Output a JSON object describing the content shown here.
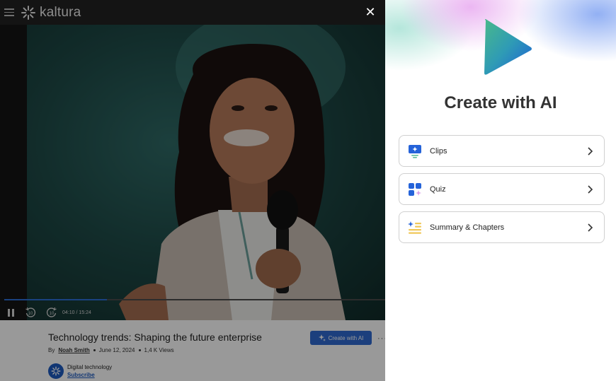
{
  "player": {
    "logo_text": "kaltura",
    "time": "04:10 / 15:24",
    "skip_back_label": "10",
    "skip_forward_label": "10",
    "progress_fraction": 0.27
  },
  "video": {
    "title": "Technology trends: Shaping the future enterprise",
    "by_label": "By",
    "author": "Noah Smith",
    "date": "June 12, 2024",
    "views": "1,4 K Views",
    "create_ai_label": "Create with AI",
    "more_label": "···"
  },
  "channel": {
    "name": "Digital technology",
    "subscribe_label": "Subscribe"
  },
  "panel": {
    "title": "Create with AI",
    "options": [
      {
        "label": "Clips",
        "icon": "clips-icon"
      },
      {
        "label": "Quiz",
        "icon": "quiz-icon"
      },
      {
        "label": "Summary & Chapters",
        "icon": "summary-icon"
      }
    ]
  },
  "colors": {
    "accent_blue": "#2f6ad0",
    "dim_overlay": "rgba(0,0,0,0.4)",
    "topbar": "#222222"
  }
}
